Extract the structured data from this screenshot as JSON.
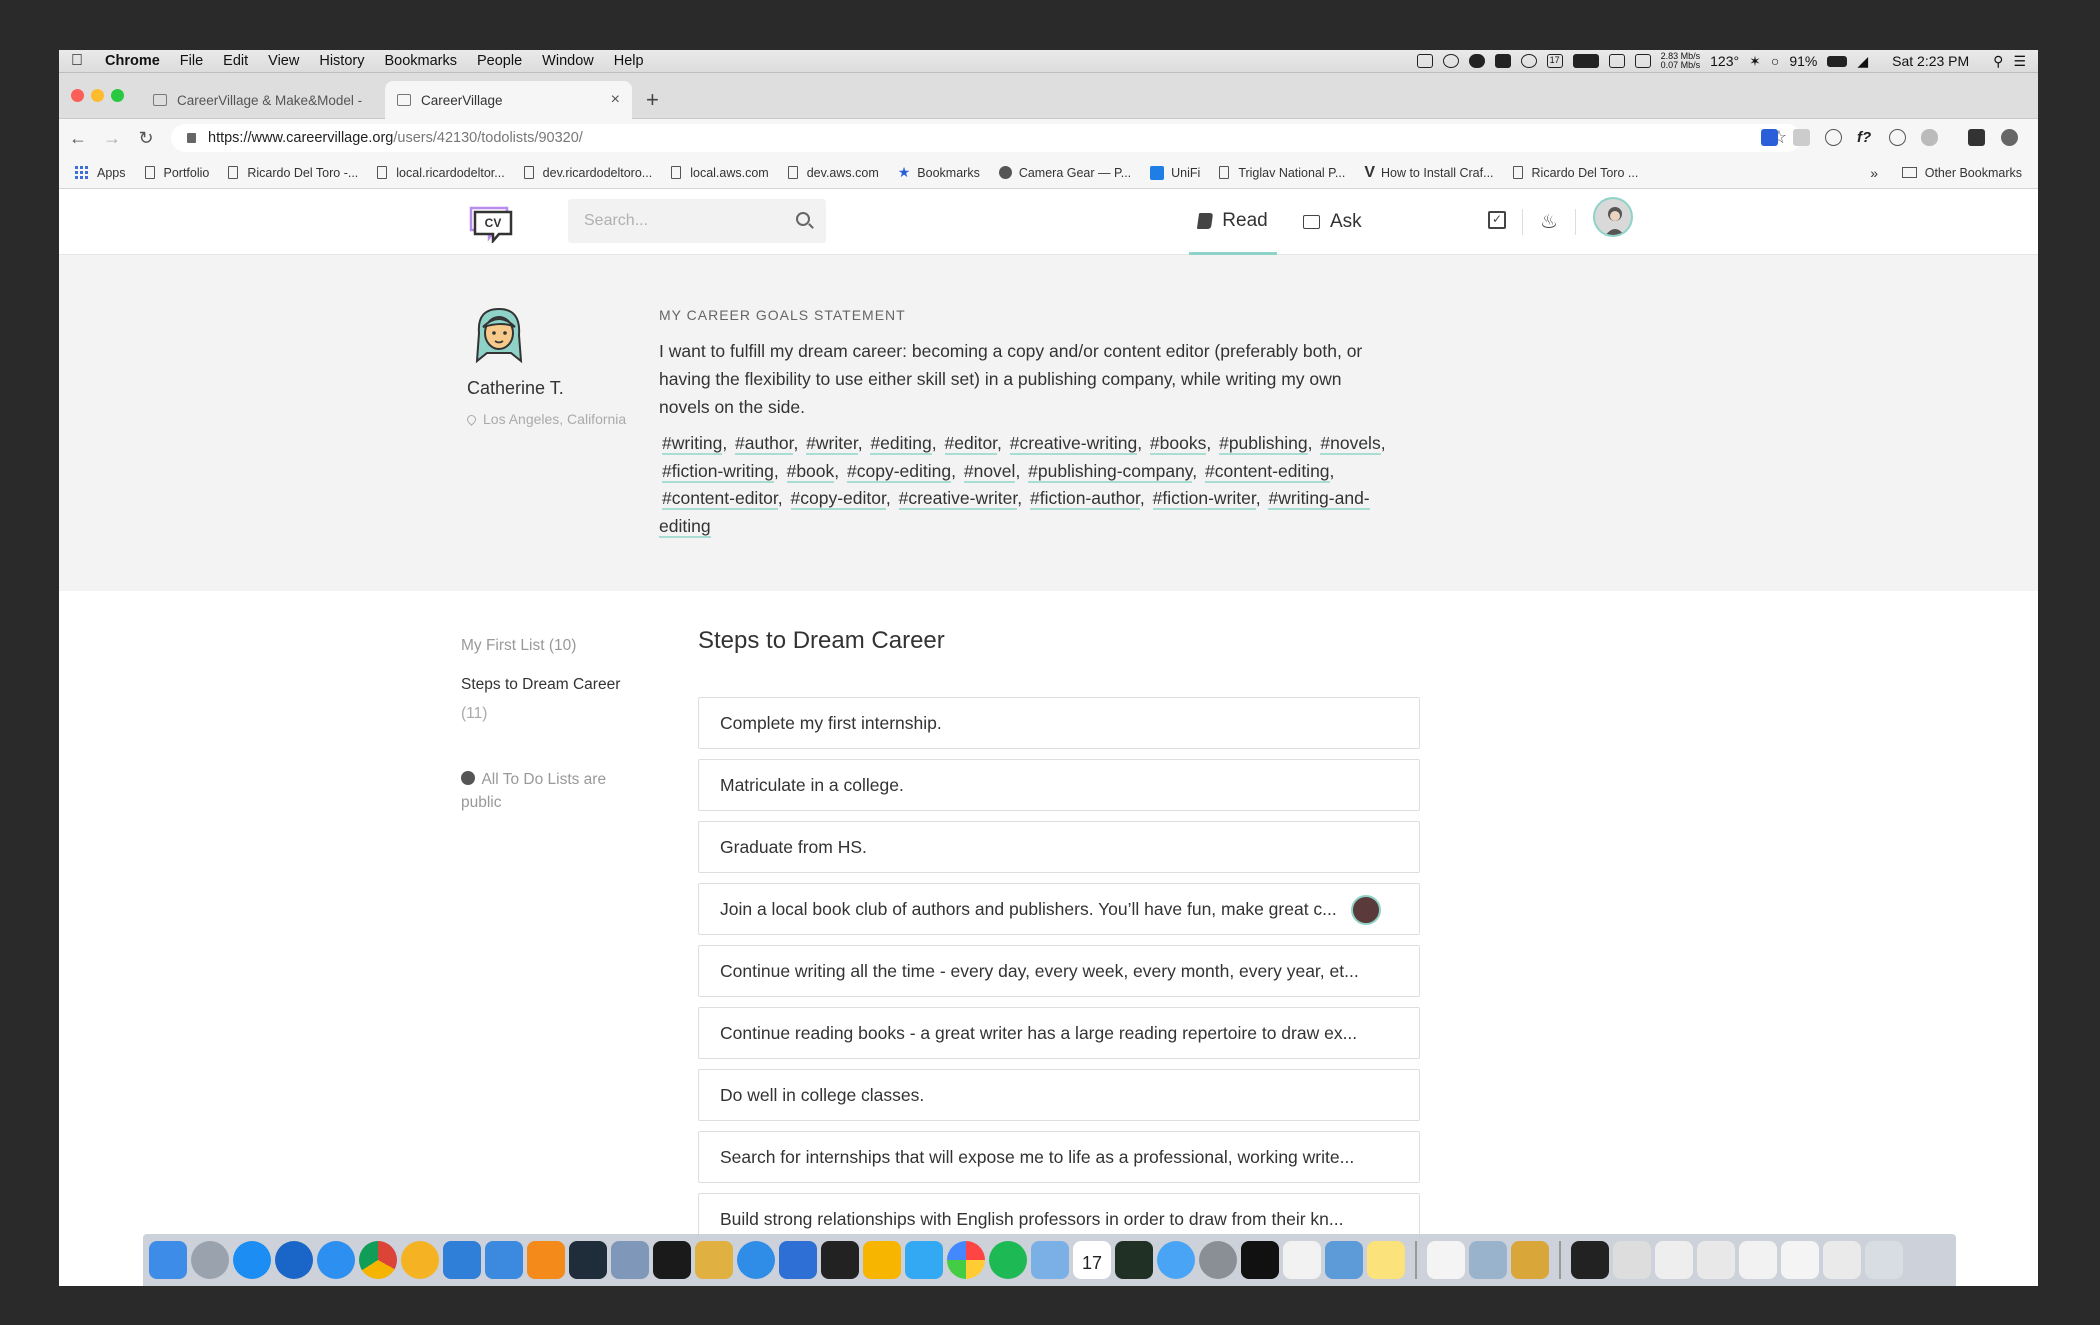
{
  "menubar": {
    "app": "Chrome",
    "menus": [
      "File",
      "Edit",
      "View",
      "History",
      "Bookmarks",
      "People",
      "Window",
      "Help"
    ],
    "net_up": "2.83 Mb/s",
    "net_down": "0.07 Mb/s",
    "temp": "123°",
    "battery": "91%",
    "clock": "Sat 2:23 PM",
    "calendar_day": "17"
  },
  "tabs": [
    {
      "title": "CareerVillage & Make&Model -"
    },
    {
      "title": "CareerVillage"
    }
  ],
  "address": {
    "host": "https://www.careervillage.org",
    "path": "/users/42130/todolists/90320/"
  },
  "bookmarks": [
    "Apps",
    "Portfolio",
    "Ricardo Del Toro -...",
    "local.ricardodeltor...",
    "dev.ricardodeltoro...",
    "local.aws.com",
    "dev.aws.com",
    "Bookmarks",
    "Camera Gear — P...",
    "UniFi",
    "Triglav National P...",
    "How to Install Craf...",
    "Ricardo Del Toro ..."
  ],
  "bookmarks_more": "»",
  "bookmarks_other": "Other Bookmarks",
  "site": {
    "logo_text": "CV",
    "search_placeholder": "Search...",
    "nav_read": "Read",
    "nav_ask": "Ask"
  },
  "profile": {
    "name": "Catherine T.",
    "location": "Los Angeles, California",
    "goals_heading": "MY CAREER GOALS STATEMENT",
    "goals_text": "I want to fulfill my dream career: becoming a copy and/or content editor (preferably both, or having the flexibility to use either skill set) in a publishing company, while writing my own novels on the side.",
    "tags": [
      "#writing",
      "#author",
      "#writer",
      "#editing",
      "#editor",
      "#creative-writing",
      "#books",
      "#publishing",
      "#novels",
      "#fiction-writing",
      "#book",
      "#copy-editing",
      "#novel",
      "#publishing-company",
      "#content-editing",
      "#content-editor",
      "#copy-editor",
      "#creative-writer",
      "#fiction-author",
      "#fiction-writer",
      "#writing-and-editing"
    ]
  },
  "sidebar": {
    "first_list": "My First List",
    "first_count": "(10)",
    "steps_list": "Steps to Dream Career",
    "steps_count": "(11)",
    "public_note": "All To Do Lists are public"
  },
  "list": {
    "title": "Steps to Dream Career",
    "items": [
      "Complete my first internship.",
      "Matriculate in a college.",
      "Graduate from HS.",
      "Join a local book club of authors and publishers. You’ll have fun, make great c...",
      "Continue writing all the time - every day, every week, every month, every year, et...",
      "Continue reading books - a great writer has a large reading repertoire to draw ex...",
      "Do well in college classes.",
      "Search for internships that will expose me to life as a professional, working write...",
      "Build strong relationships with English professors in order to draw from their kn..."
    ]
  },
  "colors": {
    "accent": "#8fd3c8",
    "page_bg": "#f3f3f3",
    "dock_bg": "#c8cdd7"
  }
}
